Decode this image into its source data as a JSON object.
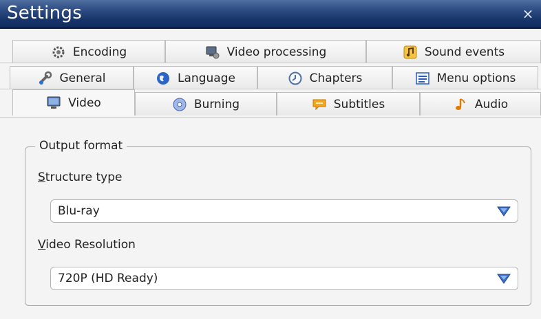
{
  "window": {
    "title": "Settings",
    "close_glyph": "×"
  },
  "tabs": {
    "row1": [
      {
        "label": "Encoding",
        "icon": "gear-icon"
      },
      {
        "label": "Video processing",
        "icon": "monitor-gear-icon"
      },
      {
        "label": "Sound events",
        "icon": "music-note-icon"
      }
    ],
    "row2": [
      {
        "label": "General",
        "icon": "wrench-icon"
      },
      {
        "label": "Language",
        "icon": "globe-icon"
      },
      {
        "label": "Chapters",
        "icon": "clock-icon"
      },
      {
        "label": "Menu options",
        "icon": "menu-list-icon"
      }
    ],
    "row3": [
      {
        "label": "Video",
        "icon": "monitor-icon",
        "selected": true
      },
      {
        "label": "Burning",
        "icon": "disc-icon"
      },
      {
        "label": "Subtitles",
        "icon": "speech-bubble-icon"
      },
      {
        "label": "Audio",
        "icon": "music-note-icon"
      }
    ]
  },
  "output_format": {
    "legend": "Output format",
    "structure_type": {
      "label_first": "S",
      "label_rest": "tructure type",
      "value": "Blu-ray"
    },
    "video_resolution": {
      "label_first": "V",
      "label_rest": "ideo Resolution",
      "value": "720P (HD Ready)"
    }
  },
  "colors": {
    "titlebar": "#173468",
    "accent_blue": "#3b6fc7",
    "icon_orange": "#f0a31a"
  }
}
